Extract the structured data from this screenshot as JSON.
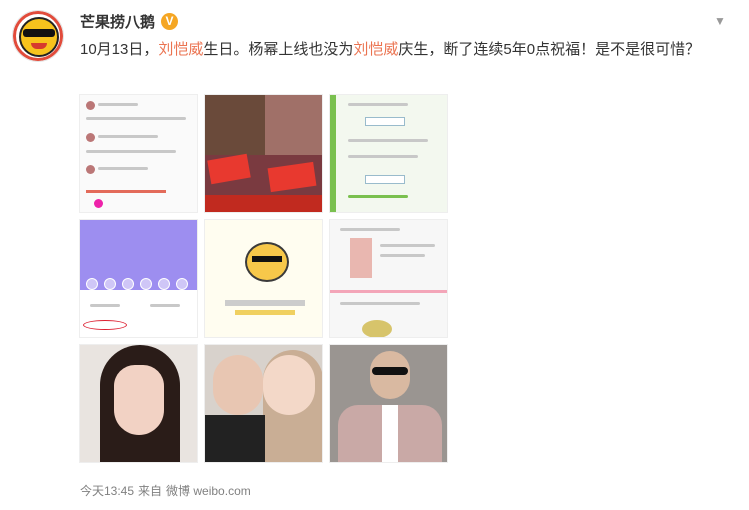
{
  "post": {
    "username": "芒果捞八鹅",
    "verified_badge": "V",
    "text_parts": [
      {
        "text": "10月13日，",
        "highlight": false
      },
      {
        "text": "刘恺威",
        "highlight": true
      },
      {
        "text": "生日。杨幂上线也没为",
        "highlight": false
      },
      {
        "text": "刘恺威",
        "highlight": true
      },
      {
        "text": "庆生，断了连续5年0点祝福！是不是很可惜？",
        "highlight": false
      }
    ],
    "meta": {
      "time": "今天13:45",
      "from_label": "来自",
      "source": "微博 weibo.com"
    }
  },
  "colors": {
    "highlight": "#eb7350",
    "verified": "#f5a623",
    "meta": "#808080"
  },
  "icons": {
    "verified": "verified-icon",
    "menu": "chevron-down-icon"
  }
}
